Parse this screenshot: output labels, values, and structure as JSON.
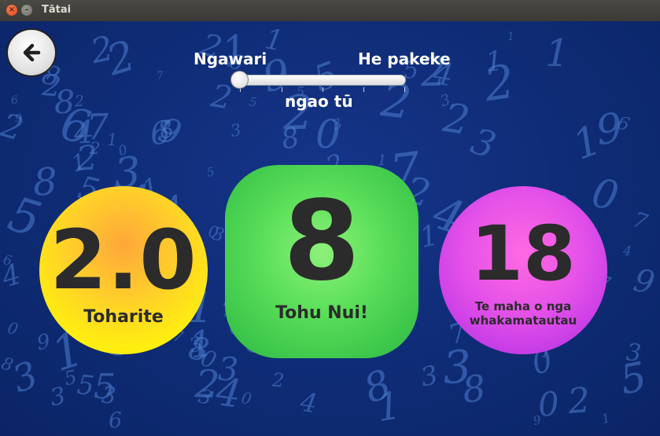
{
  "window": {
    "title": "Tātai",
    "close_glyph": "×",
    "minimize_glyph": "–"
  },
  "back_button": {
    "icon": "arrow-left-icon"
  },
  "difficulty": {
    "easy_label": "Ngawari",
    "hard_label": "He pakeke",
    "caption": "ngao tū",
    "level": 0
  },
  "stats": {
    "average": {
      "value": "2.0",
      "label": "Toharite",
      "color": "#ffee10"
    },
    "top_score": {
      "value": "8",
      "label": "Tohu Nui!",
      "color": "#5de05b"
    },
    "test_count": {
      "value": "18",
      "label": "Te maha o nga whakamatautau",
      "color": "#e552e8"
    }
  }
}
